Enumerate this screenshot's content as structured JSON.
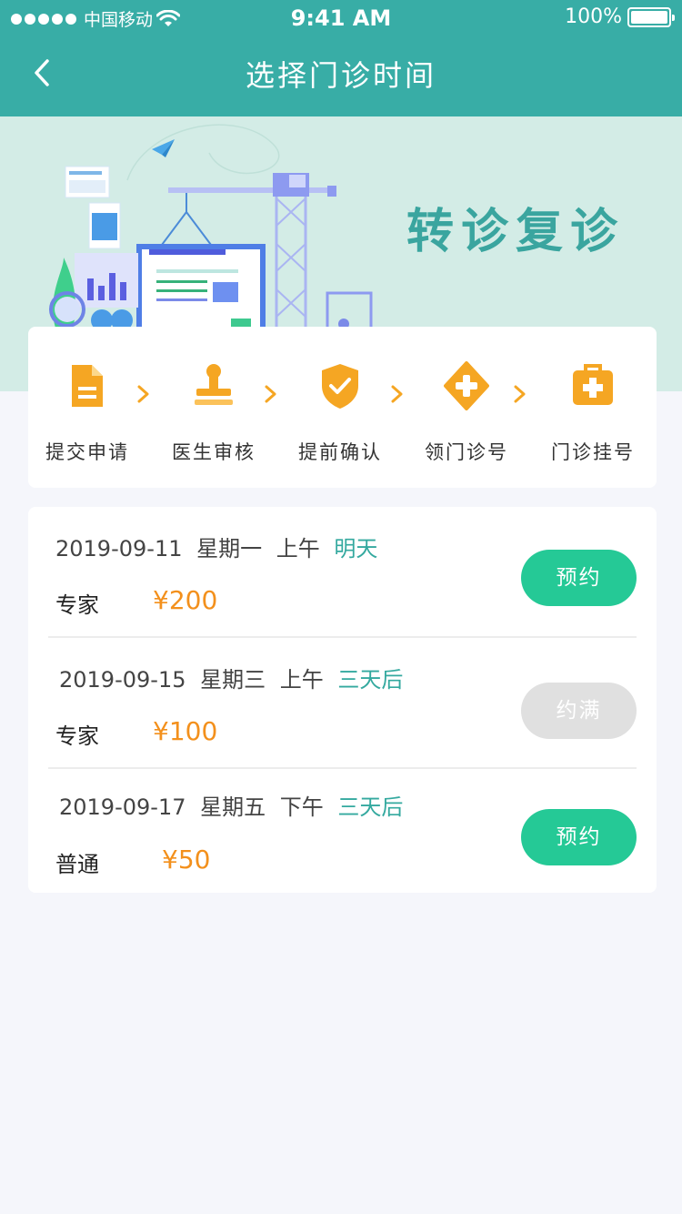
{
  "status_bar": {
    "carrier": "中国移动",
    "time": "9:41 AM",
    "battery": "100%"
  },
  "nav": {
    "title": "选择门诊时间",
    "back_icon": "chevron-left-icon"
  },
  "banner": {
    "slogan": "转诊复诊"
  },
  "steps": [
    {
      "label": "提交申请",
      "icon": "document-icon"
    },
    {
      "label": "医生审核",
      "icon": "stamp-icon"
    },
    {
      "label": "提前确认",
      "icon": "shield-check-icon"
    },
    {
      "label": "领门诊号",
      "icon": "plus-diamond-icon"
    },
    {
      "label": "门诊挂号",
      "icon": "medical-kit-icon"
    }
  ],
  "slots": [
    {
      "date": "2019-09-11",
      "weekday": "星期一",
      "period": "上午",
      "relative": "明天",
      "type": "专家",
      "price": "¥200",
      "button": "预约",
      "available": true
    },
    {
      "date": "2019-09-15",
      "weekday": "星期三",
      "period": "上午",
      "relative": "三天后",
      "type": "专家",
      "price": "¥100",
      "button": "约满",
      "available": false
    },
    {
      "date": "2019-09-17",
      "weekday": "星期五",
      "period": "下午",
      "relative": "三天后",
      "type": "普通",
      "price": "¥50",
      "button": "预约",
      "available": true
    }
  ],
  "colors": {
    "header": "#38ada6",
    "banner": "#d3ece6",
    "accent_green": "#25c996",
    "price_orange": "#f3901c",
    "step_orange": "#f5a623",
    "disabled": "#e0e0e0"
  }
}
